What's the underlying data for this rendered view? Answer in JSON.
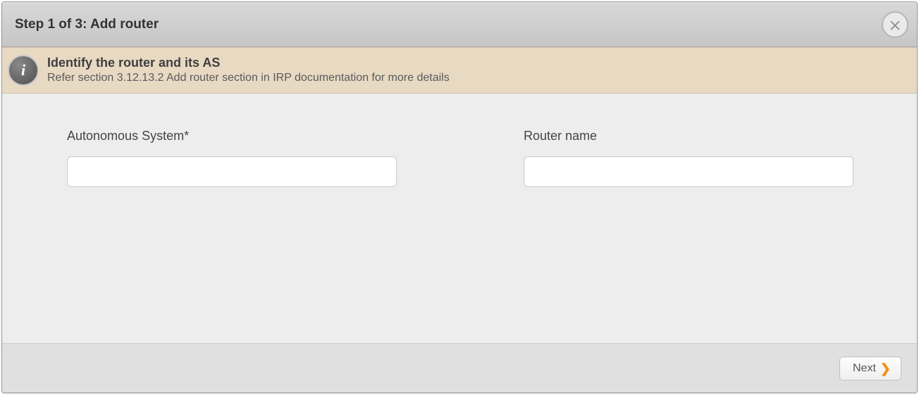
{
  "dialog": {
    "title": "Step 1 of 3: Add router"
  },
  "info": {
    "title": "Identify the router and its AS",
    "subtitle": "Refer section 3.12.13.2 Add router section in IRP documentation for more details"
  },
  "form": {
    "autonomous_system": {
      "label": "Autonomous System*",
      "value": ""
    },
    "router_name": {
      "label": "Router name",
      "value": ""
    }
  },
  "footer": {
    "next_label": "Next"
  }
}
